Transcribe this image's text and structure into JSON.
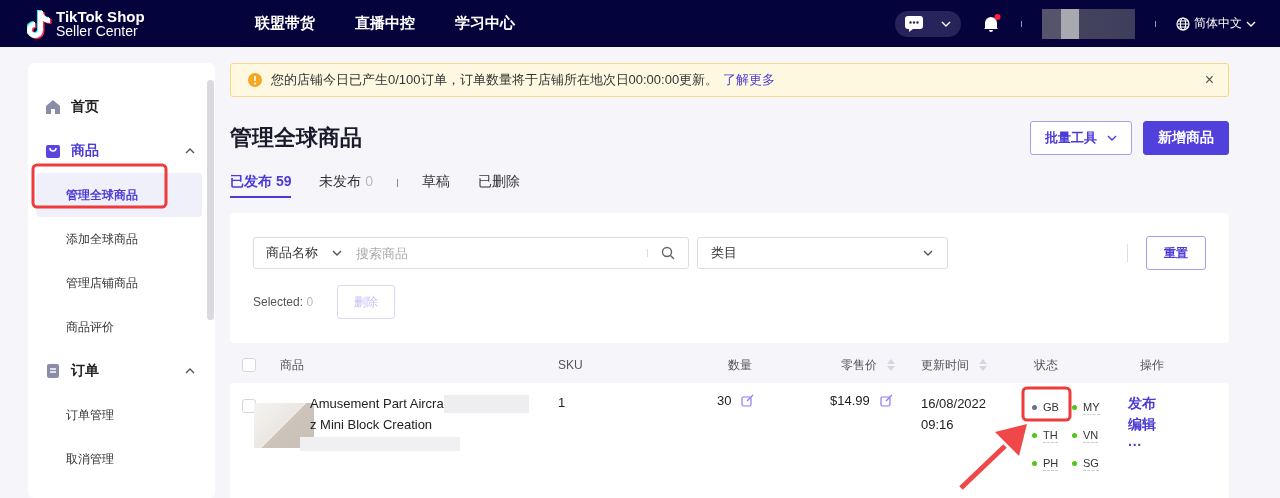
{
  "header": {
    "brand_line1": "TikTok Shop",
    "brand_line2": "Seller Center",
    "nav": [
      "联盟带货",
      "直播中控",
      "学习中心"
    ],
    "notification_dot": true,
    "language": "简体中文"
  },
  "sidebar": {
    "groups": [
      {
        "label": "首页",
        "selected": false
      },
      {
        "label": "商品",
        "selected": true,
        "expanded": true,
        "children": [
          {
            "label": "管理全球商品",
            "selected": true,
            "highlighted": true
          },
          {
            "label": "添加全球商品",
            "selected": false,
            "highlighted": false
          },
          {
            "label": "管理店铺商品",
            "selected": false,
            "highlighted": false
          },
          {
            "label": "商品评价",
            "selected": false,
            "highlighted": false
          }
        ]
      },
      {
        "label": "订单",
        "selected": false,
        "expanded": true,
        "children": [
          {
            "label": "订单管理",
            "selected": false,
            "highlighted": false
          },
          {
            "label": "取消管理",
            "selected": false,
            "highlighted": false
          }
        ]
      }
    ]
  },
  "notice": {
    "text": "您的店铺今日已产生0/100订单，订单数量将于店铺所在地次日00:00:00更新。",
    "link": "了解更多",
    "close": "×"
  },
  "page_title": "管理全球商品",
  "buttons": [
    {
      "label": "批量工具",
      "kind": "dropdown"
    },
    {
      "label": "新增商品",
      "kind": "primary"
    }
  ],
  "tabs": [
    {
      "label": "已发布",
      "count": "59",
      "selected": true
    },
    {
      "label": "未发布",
      "count": "0",
      "selected": false
    },
    {
      "label": "草稿",
      "selected": false
    },
    {
      "label": "已删除",
      "selected": false
    }
  ],
  "filters": {
    "field_select": "商品名称",
    "search": {
      "placeholder": "搜索商品"
    },
    "category": {
      "placeholder": "类目"
    },
    "reset": "重置",
    "selected_label": "Selected:",
    "selected_count": "0",
    "delete": {
      "label": "删除",
      "disabled": true
    }
  },
  "table": {
    "select_all_checked": false,
    "columns": [
      {
        "label": "商品",
        "sortable": false
      },
      {
        "label": "SKU",
        "sortable": false
      },
      {
        "label": "数量",
        "sortable": false
      },
      {
        "label": "零售价",
        "sortable": true
      },
      {
        "label": "更新时间",
        "sortable": true
      },
      {
        "label": "状态",
        "sortable": false
      },
      {
        "label": "操作",
        "sortable": false
      }
    ],
    "rows": [
      {
        "checked": false,
        "name_lines": [
          "Amusement Part Aircra",
          "z Mini Block Creation"
        ],
        "sku": "1",
        "quantity": "30",
        "price": "$14.99",
        "updated": [
          "16/08/2022",
          "09:16"
        ],
        "regions": [
          {
            "code": "GB",
            "color": "#6b6f87",
            "highlighted": true,
            "arrow": true
          },
          {
            "code": "MY",
            "color": "#52c41a",
            "highlighted": false,
            "arrow": false
          },
          {
            "code": "TH",
            "color": "#52c41a",
            "highlighted": false,
            "arrow": false
          },
          {
            "code": "VN",
            "color": "#52c41a",
            "highlighted": false,
            "arrow": false
          },
          {
            "code": "PH",
            "color": "#52c41a",
            "highlighted": false,
            "arrow": false
          },
          {
            "code": "SG",
            "color": "#52c41a",
            "highlighted": false,
            "arrow": false
          }
        ],
        "actions": [
          "发布",
          "编辑",
          "···"
        ]
      }
    ]
  }
}
